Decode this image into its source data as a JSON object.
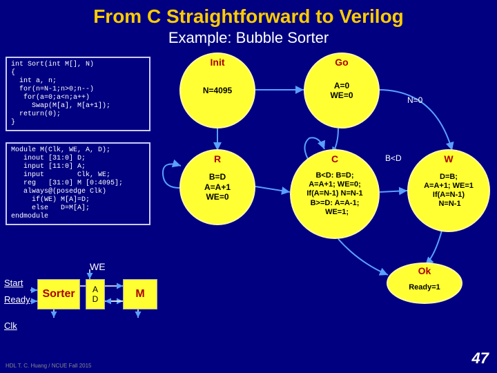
{
  "title": "From C Straightforward to Verilog",
  "subtitle": "Example: Bubble Sorter",
  "code_c": "int Sort(int M[], N)\n{\n  int a, n;\n  for(n=N-1;n>0;n--)\n   for(a=0;a<n;a++)\n     Swap(M[a], M[a+1]);\n  return(0);\n}",
  "code_v": "Module M(Clk, WE, A, D);\n   inout [31:0] D;\n   input [11:0] A;\n   input        Clk, WE;\n   reg   [31:0] M [0:4095];\n   always@(posedge Clk)\n     if(WE) M[A]=D;\n     else   D=M[A];\nendmodule",
  "states": {
    "init": {
      "name": "Init",
      "body": "N=4095"
    },
    "go": {
      "name": "Go",
      "body": "A=0\nWE=0"
    },
    "r": {
      "name": "R",
      "body": "B=D\nA=A+1\nWE=0"
    },
    "c": {
      "name": "C",
      "body": "B<D: B=D;\nA=A+1; WE=0;\nIf(A=N-1) N=N-1\nB>=D: A=A-1;\n  WE=1;"
    },
    "w": {
      "name": "W",
      "body": "D=B;\nA=A+1; WE=1\nIf(A=N-1)\n N=N-1"
    },
    "ok": {
      "name": "Ok",
      "body": "Ready=1"
    }
  },
  "edge_labels": {
    "n0": "N=0",
    "bd": "B<D"
  },
  "hw": {
    "we": "WE",
    "start": "Start",
    "ready": "Ready",
    "clk": "Clk",
    "sorter": "Sorter",
    "a": "A",
    "d": "D",
    "m": "M"
  },
  "footer": "HDL    T. C. Huang / NCUE  Fall 2015",
  "pagenum": "47"
}
